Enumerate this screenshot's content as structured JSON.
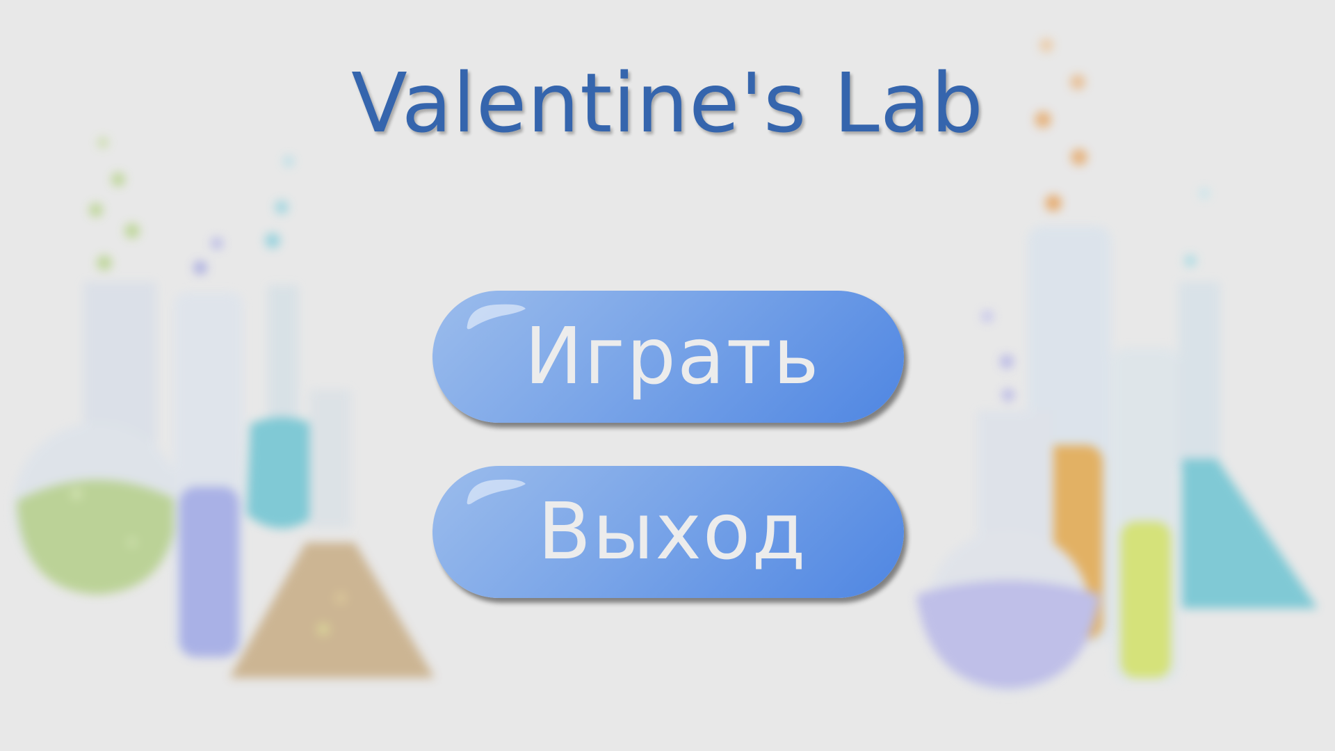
{
  "title": "Valentine's Lab",
  "menu": {
    "play_label": "Играть",
    "exit_label": "Выход"
  },
  "colors": {
    "background": "#e8e8e8",
    "title": "#3565ad",
    "button_light": "#9bbcec",
    "button_dark": "#4f86e2",
    "button_text": "#ececec"
  },
  "background_art": {
    "left_group": [
      "round-flask-green",
      "test-tube-purple",
      "flask-teal",
      "conical-flask-brown"
    ],
    "right_group": [
      "round-flask-lavender",
      "test-tube-orange",
      "test-tube-lime",
      "conical-flask-teal"
    ]
  }
}
